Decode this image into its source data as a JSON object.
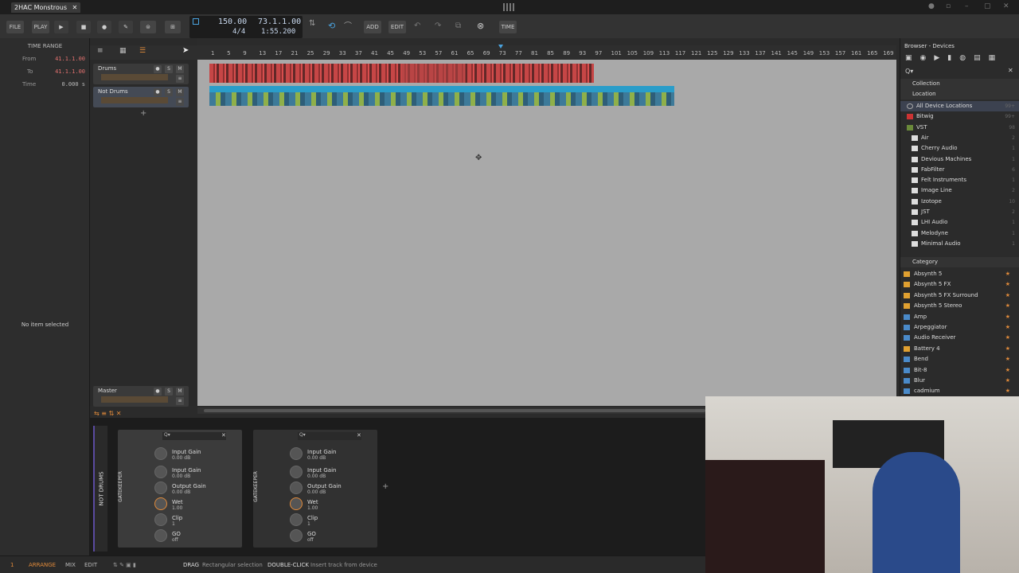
{
  "tab": {
    "title": "2HAC Monstrous",
    "close": "✕"
  },
  "toolbar": {
    "file": "FILE",
    "play_label": "PLAY",
    "add": "ADD",
    "edit": "EDIT",
    "time": "TIME"
  },
  "transport": {
    "tempo": "150.00",
    "signature": "4/4",
    "position": "73.1.1.00",
    "time": "1:55.200"
  },
  "time_range": {
    "title": "TIME RANGE",
    "from_label": "From",
    "from_value": "41.1.1.00",
    "to_label": "To",
    "to_value": "41.1.1.00",
    "time_label": "Time",
    "time_value": "0.000 s"
  },
  "inspector": {
    "empty": "No item selected"
  },
  "tracks": [
    {
      "name": "Drums",
      "s": "S",
      "m": "M"
    },
    {
      "name": "Not Drums",
      "s": "S",
      "m": "M"
    }
  ],
  "master": {
    "name": "Master",
    "s": "S",
    "m": "M"
  },
  "ruler": [
    "1",
    "5",
    "9",
    "13",
    "17",
    "21",
    "25",
    "29",
    "33",
    "37",
    "41",
    "45",
    "49",
    "53",
    "57",
    "61",
    "65",
    "69",
    "73",
    "77",
    "81",
    "85",
    "89",
    "93",
    "97",
    "101",
    "105",
    "109",
    "113",
    "117",
    "121",
    "125",
    "129",
    "133",
    "137",
    "141",
    "145",
    "149",
    "153",
    "157",
    "161",
    "165",
    "169"
  ],
  "browser": {
    "title": "Browser - Devices",
    "collection": "Collection",
    "location": "Location",
    "locations": [
      {
        "name": "All Device Locations",
        "count": "99+"
      },
      {
        "name": "Bitwig",
        "count": "99+"
      },
      {
        "name": "VST",
        "count": "98"
      },
      {
        "name": "Air",
        "count": "2"
      },
      {
        "name": "Cherry Audio",
        "count": "1"
      },
      {
        "name": "Devious Machines",
        "count": "1"
      },
      {
        "name": "FabFilter",
        "count": "6"
      },
      {
        "name": "Felt Instruments",
        "count": "1"
      },
      {
        "name": "Image Line",
        "count": "2"
      },
      {
        "name": "Izotope",
        "count": "10"
      },
      {
        "name": "JST",
        "count": "2"
      },
      {
        "name": "LHI Audio",
        "count": "1"
      },
      {
        "name": "Melodyne",
        "count": "1"
      },
      {
        "name": "Minimal Audio",
        "count": "1"
      }
    ],
    "category": "Category",
    "categories": [
      "Absynth 5",
      "Absynth 5 FX",
      "Absynth 5 FX Surround",
      "Absynth 5 Stereo",
      "Amp",
      "Arpeggiator",
      "Audio Receiver",
      "Battery 4",
      "Bend",
      "Bit-8",
      "Blur",
      "cadmium"
    ]
  },
  "devices": {
    "track_label": "NOT DRUMS",
    "list": [
      {
        "name": "GATEKEEPER",
        "params": [
          {
            "label": "Input Gain",
            "value": "0.00 dB"
          },
          {
            "label": "Input Gain",
            "value": "0.00 dB"
          },
          {
            "label": "Output Gain",
            "value": "0.00 dB"
          },
          {
            "label": "Wet",
            "value": "1.00"
          },
          {
            "label": "Clip",
            "value": "1"
          },
          {
            "label": "GO",
            "value": "off"
          }
        ]
      },
      {
        "name": "GATEKEEPER",
        "params": [
          {
            "label": "Input Gain",
            "value": "0.00 dB"
          },
          {
            "label": "Input Gain",
            "value": "0.00 dB"
          },
          {
            "label": "Output Gain",
            "value": "0.00 dB"
          },
          {
            "label": "Wet",
            "value": "1.00"
          },
          {
            "label": "Clip",
            "value": "1"
          },
          {
            "label": "GO",
            "value": "off"
          }
        ]
      }
    ]
  },
  "status": {
    "index": "1",
    "arrange": "ARRANGE",
    "mix": "MIX",
    "edit": "EDIT",
    "drag_key": "DRAG",
    "drag_desc": "Rectangular selection",
    "dbl_key": "DOUBLE-CLICK",
    "dbl_desc": "Insert track from device"
  }
}
